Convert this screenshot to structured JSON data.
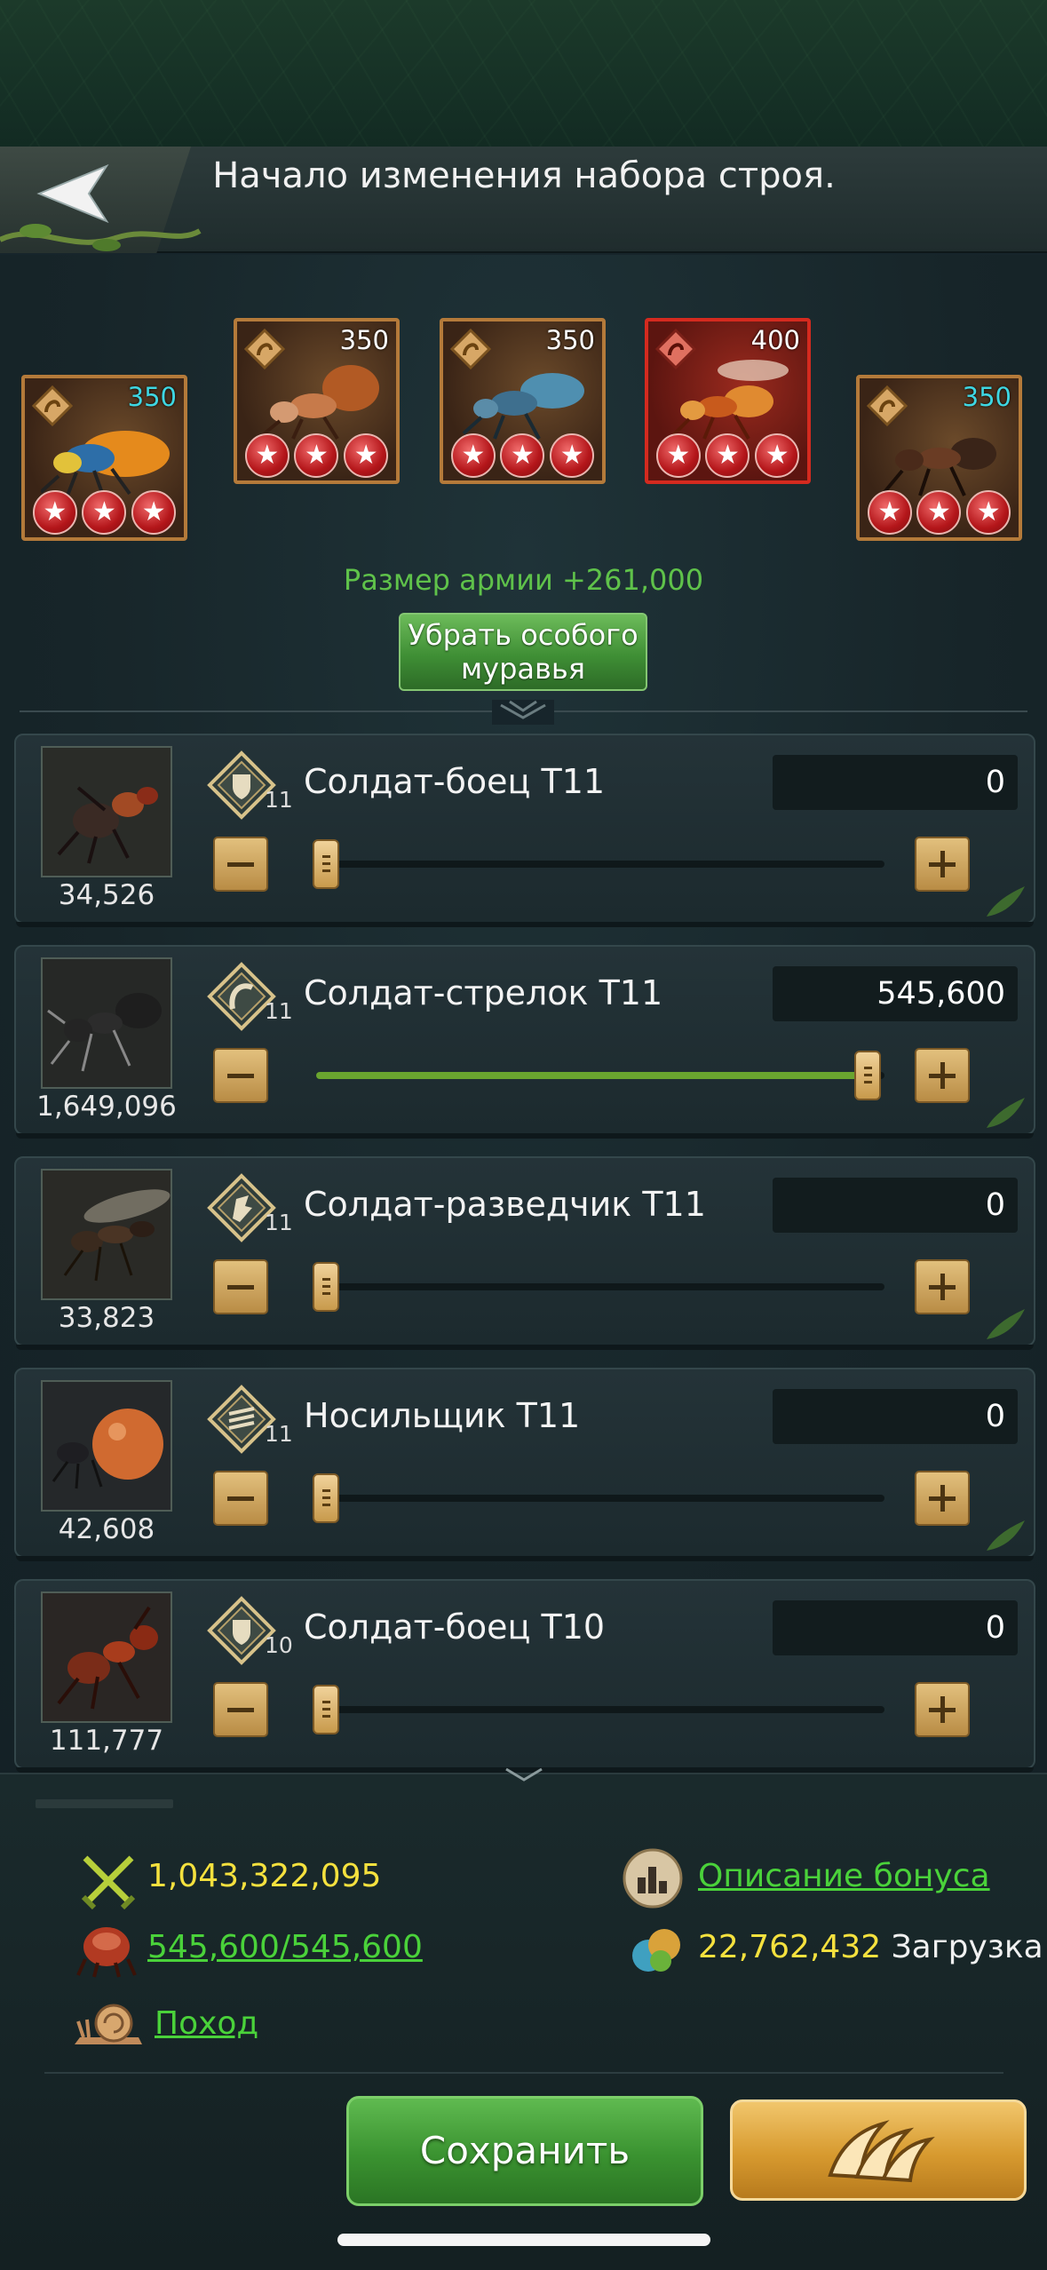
{
  "header": {
    "title": "Начало изменения набора строя."
  },
  "special_ants": [
    {
      "level": "350",
      "level_color": "#3ed7e3",
      "stars": 3,
      "frame": "orange"
    },
    {
      "level": "350",
      "level_color": "#ffffff",
      "stars": 3,
      "frame": "orange"
    },
    {
      "level": "350",
      "level_color": "#ffffff",
      "stars": 3,
      "frame": "orange"
    },
    {
      "level": "400",
      "level_color": "#ffffff",
      "stars": 3,
      "frame": "red"
    },
    {
      "level": "350",
      "level_color": "#3ed7e3",
      "stars": 3,
      "frame": "orange"
    }
  ],
  "army_size_label": "Размер армии +261,000",
  "remove_special_button": "Убрать особого муравья",
  "units": [
    {
      "count": "34,526",
      "tier": "11",
      "name": "Солдат-боец T11",
      "quantity": "0",
      "icon": "shield-icon",
      "slider_fraction": 0
    },
    {
      "count": "1,649,096",
      "tier": "11",
      "name": "Солдат-стрелок T11",
      "quantity": "545,600",
      "icon": "bow-icon",
      "slider_fraction": 1
    },
    {
      "count": "33,823",
      "tier": "11",
      "name": "Солдат-разведчик T11",
      "quantity": "0",
      "icon": "scout-icon",
      "slider_fraction": 0
    },
    {
      "count": "42,608",
      "tier": "11",
      "name": "Носильщик T11",
      "quantity": "0",
      "icon": "carrier-icon",
      "slider_fraction": 0
    },
    {
      "count": "111,777",
      "tier": "10",
      "name": "Солдат-боец T10",
      "quantity": "0",
      "icon": "shield-icon",
      "slider_fraction": 0
    }
  ],
  "summary": {
    "power": "1,043,322,095",
    "bonus_link": "Описание бонуса",
    "troops": "545,600/545,600",
    "load_value": "22,762,432",
    "load_label": "Загрузка",
    "march_link": "Поход"
  },
  "buttons": {
    "save": "Сохранить"
  },
  "colors": {
    "army_size": "#5fc24a",
    "power": "#f5e13e",
    "link": "#4ad23a"
  }
}
